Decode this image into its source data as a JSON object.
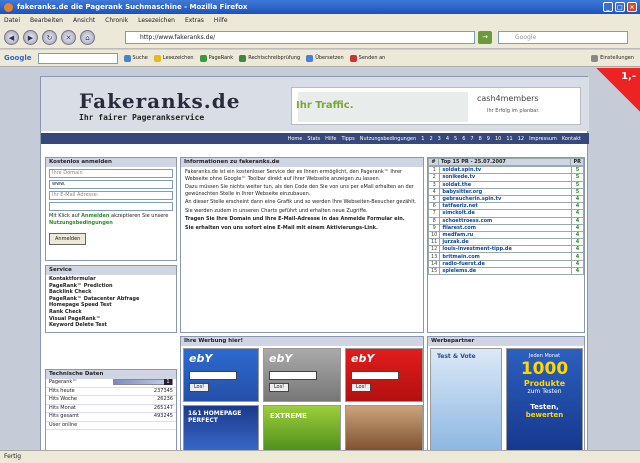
{
  "window": {
    "title": "fakeranks.de die Pagerank Suchmaschine - Mozilla Firefox"
  },
  "menu": [
    "Datei",
    "Bearbeiten",
    "Ansicht",
    "Chronik",
    "Lesezeichen",
    "Extras",
    "Hilfe"
  ],
  "address": {
    "url": "http://www.fakeranks.de/",
    "search_placeholder": "Google"
  },
  "gbar": {
    "logo": "Google",
    "suche": "Suche",
    "lesezeichen": "Lesezeichen",
    "pagerank": "PageRank",
    "rechtschreib": "Rechtschreibprüfung",
    "uebersetzen": "Übersetzen",
    "senden": "Senden an",
    "einstellungen": "Einstellungen"
  },
  "corner_badge": "1,-",
  "site": {
    "logo": "Fakeranks.de",
    "slogan": "Ihr fairer Pagerankservice",
    "banner": {
      "text": "Ihr Traffic.",
      "brand": "cash4members",
      "sub": "Ihr Erfolg im planbar."
    },
    "nav": [
      "Home",
      "Stats",
      "Hilfe",
      "Tipps",
      "Nutzungsbedingungen",
      "1",
      "2",
      "3",
      "4",
      "5",
      "6",
      "7",
      "8",
      "9",
      "10",
      "11",
      "12",
      "Impressum",
      "Kontakt"
    ]
  },
  "login": {
    "title": "Kostenlos anmelden",
    "domain_placeholder": "Ihre Domain",
    "domain_value": "www.",
    "email_placeholder": "Ihr E-Mail Adresse:",
    "hint_a": "Mit Klick auf",
    "hint_link": "Anmelden",
    "hint_b": "akzeptieren Sie unsere",
    "hint_terms": "Nutzungsbedingungen",
    "button": "Anmelden"
  },
  "services": {
    "title": "Service",
    "items": [
      "Kontaktformular",
      "PageRank™ Prediction",
      "Backlink Check",
      "PageRank™ Datacenter Abfrage",
      "Homepage Speed Test",
      "Rank Check",
      "Visual PageRank™",
      "Keyword Delete Test"
    ]
  },
  "tech": {
    "title": "Technische Daten",
    "rows": [
      {
        "label": "Pagerank™",
        "value": "1"
      },
      {
        "label": "Hits heute",
        "value": "237345"
      },
      {
        "label": "Hits Woche",
        "value": "26236"
      },
      {
        "label": "Hits Monat",
        "value": "265147"
      },
      {
        "label": "Hits gesamt",
        "value": "493245"
      },
      {
        "label": "User online",
        "value": ""
      }
    ]
  },
  "info": {
    "title": "Informationen zu fakeranks.de",
    "paragraphs": [
      "Fakeranks.de ist ein kostenloser Service der es Ihnen ermöglicht, den Pagerank™ Ihrer Webseite ohne Google™ Toolbar direkt auf Ihrer Webseite anzeigen zu lassen.",
      "Dazu müssen Sie nichts weiter tun, als den Code den Sie von uns per eMail erhalten an der gewünschten Stelle in Ihrer Webseite einzubauen.",
      "An dieser Stelle erscheint dann eine Grafik und so werden Ihre Webseiten-Besucher gezählt.",
      "Sie werden zudem in unseren Charts geführt und erhalten neue Zugriffe."
    ],
    "bold1": "Tragen Sie Ihre Domain und Ihre E-Mail-Adresse in das Anmelde Formular ein.",
    "bold2": "Sie erhalten von uns sofort eine E-Mail mit einem Aktivierungs-Link."
  },
  "werbung": {
    "title": "Ihre Werbung hier!",
    "ebay": "ebY",
    "ebay_btn": "Los!",
    "ad4": "1&1 HOMEPAGE PERFECT",
    "ad5": "EXTREME"
  },
  "top15": {
    "title": "Top 15 PR - 25.07.2007",
    "col_hash": "#",
    "col_pr": "PR",
    "rows": [
      {
        "n": "1",
        "url": "soldat.spin.tv",
        "pr": "5"
      },
      {
        "n": "2",
        "url": "sonikede.tv",
        "pr": "5"
      },
      {
        "n": "3",
        "url": "soldat.the",
        "pr": "5"
      },
      {
        "n": "4",
        "url": "babysitter.org",
        "pr": "5"
      },
      {
        "n": "5",
        "url": "gebraucherin.spin.tv",
        "pr": "4"
      },
      {
        "n": "6",
        "url": "tatfaeriz.net",
        "pr": "4"
      },
      {
        "n": "7",
        "url": "simckolt.de",
        "pr": "4"
      },
      {
        "n": "8",
        "url": "schoettroess.com",
        "pr": "4"
      },
      {
        "n": "9",
        "url": "filarest.com",
        "pr": "4"
      },
      {
        "n": "10",
        "url": "medfam.ru",
        "pr": "4"
      },
      {
        "n": "11",
        "url": "jurzak.de",
        "pr": "4"
      },
      {
        "n": "12",
        "url": "louis-investment-tipp.de",
        "pr": "4"
      },
      {
        "n": "13",
        "url": "britmain.com",
        "pr": "4"
      },
      {
        "n": "14",
        "url": "radio-fuerst.de",
        "pr": "4"
      },
      {
        "n": "15",
        "url": "spielems.de",
        "pr": "4"
      }
    ]
  },
  "partner": {
    "title": "Werbepartner",
    "testvote": "Test & Vote",
    "jeden": "Jeden Monat",
    "big": "1000",
    "produkte": "Produkte",
    "zum": "zum Testen",
    "testen": "Testen,",
    "bewerten": "bewerten"
  },
  "status": "Fertig"
}
